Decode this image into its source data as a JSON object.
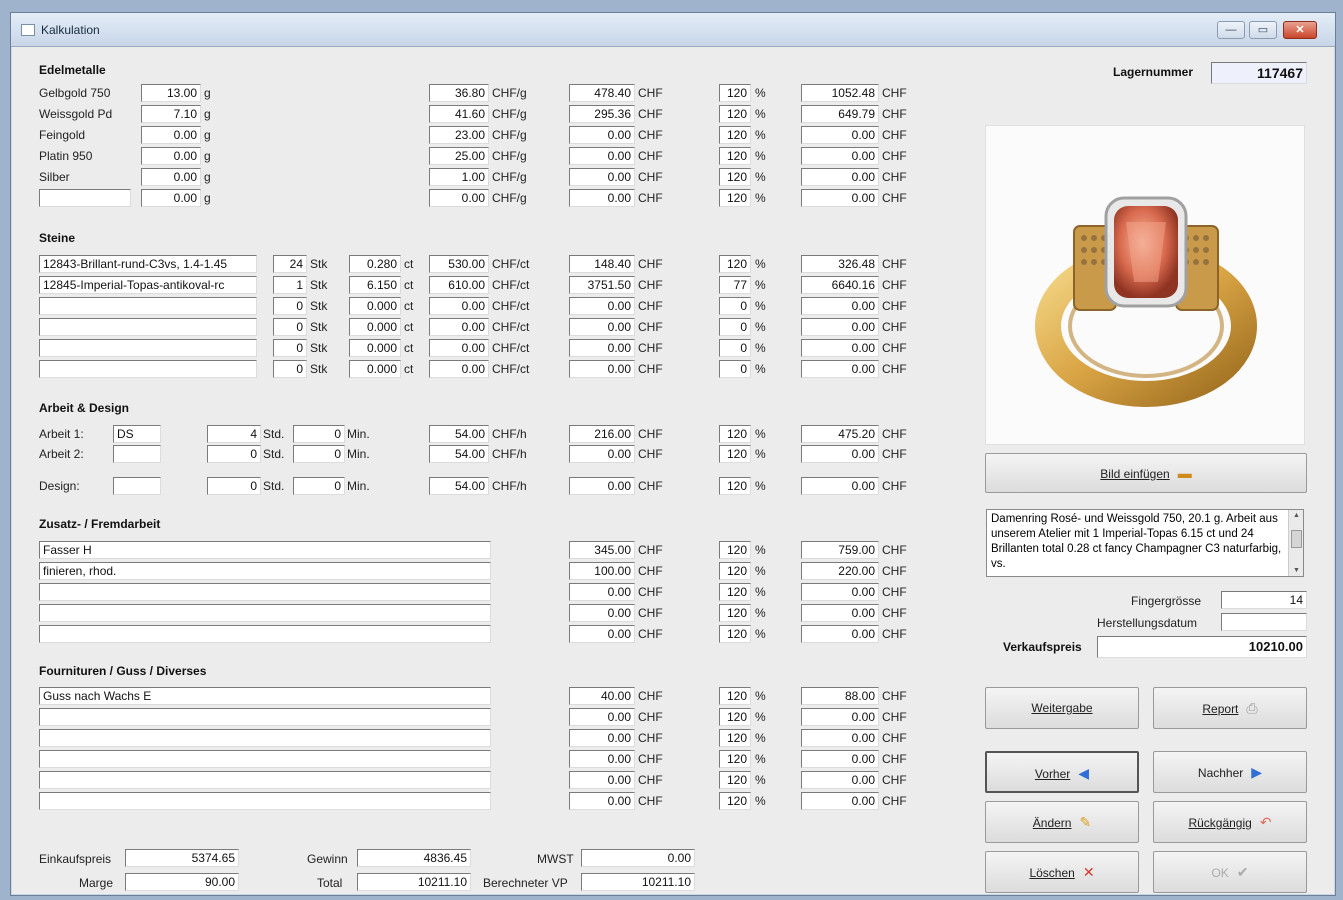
{
  "window": {
    "title": "Kalkulation",
    "minimize": "—",
    "maximize": "▭",
    "close": "✕"
  },
  "lagernummer": {
    "label": "Lagernummer",
    "value": "117467"
  },
  "edelmetalle": {
    "title": "Edelmetalle",
    "rows": [
      {
        "name": "Gelbgold 750",
        "qty": "13.00",
        "qty_unit": "g",
        "price": "36.80",
        "price_unit": "CHF/g",
        "cost": "478.40",
        "cost_unit": "CHF",
        "pct": "120",
        "pct_unit": "%",
        "total": "1052.48",
        "total_unit": "CHF"
      },
      {
        "name": "Weissgold Pd",
        "qty": "7.10",
        "qty_unit": "g",
        "price": "41.60",
        "price_unit": "CHF/g",
        "cost": "295.36",
        "cost_unit": "CHF",
        "pct": "120",
        "pct_unit": "%",
        "total": "649.79",
        "total_unit": "CHF"
      },
      {
        "name": "Feingold",
        "qty": "0.00",
        "qty_unit": "g",
        "price": "23.00",
        "price_unit": "CHF/g",
        "cost": "0.00",
        "cost_unit": "CHF",
        "pct": "120",
        "pct_unit": "%",
        "total": "0.00",
        "total_unit": "CHF"
      },
      {
        "name": "Platin 950",
        "qty": "0.00",
        "qty_unit": "g",
        "price": "25.00",
        "price_unit": "CHF/g",
        "cost": "0.00",
        "cost_unit": "CHF",
        "pct": "120",
        "pct_unit": "%",
        "total": "0.00",
        "total_unit": "CHF"
      },
      {
        "name": "Silber",
        "qty": "0.00",
        "qty_unit": "g",
        "price": "1.00",
        "price_unit": "CHF/g",
        "cost": "0.00",
        "cost_unit": "CHF",
        "pct": "120",
        "pct_unit": "%",
        "total": "0.00",
        "total_unit": "CHF"
      },
      {
        "name": "",
        "qty": "0.00",
        "qty_unit": "g",
        "price": "0.00",
        "price_unit": "CHF/g",
        "cost": "0.00",
        "cost_unit": "CHF",
        "pct": "120",
        "pct_unit": "%",
        "total": "0.00",
        "total_unit": "CHF"
      }
    ]
  },
  "steine": {
    "title": "Steine",
    "rows": [
      {
        "name": "12843-Brillant-rund-C3vs, 1.4-1.45",
        "stk": "24",
        "stk_unit": "Stk",
        "ct": "0.280",
        "ct_unit": "ct",
        "price": "530.00",
        "price_unit": "CHF/ct",
        "cost": "148.40",
        "cost_unit": "CHF",
        "pct": "120",
        "pct_unit": "%",
        "total": "326.48",
        "total_unit": "CHF"
      },
      {
        "name": "12845-Imperial-Topas-antikoval-rc",
        "stk": "1",
        "stk_unit": "Stk",
        "ct": "6.150",
        "ct_unit": "ct",
        "price": "610.00",
        "price_unit": "CHF/ct",
        "cost": "3751.50",
        "cost_unit": "CHF",
        "pct": "77",
        "pct_unit": "%",
        "total": "6640.16",
        "total_unit": "CHF"
      },
      {
        "name": "",
        "stk": "0",
        "stk_unit": "Stk",
        "ct": "0.000",
        "ct_unit": "ct",
        "price": "0.00",
        "price_unit": "CHF/ct",
        "cost": "0.00",
        "cost_unit": "CHF",
        "pct": "0",
        "pct_unit": "%",
        "total": "0.00",
        "total_unit": "CHF"
      },
      {
        "name": "",
        "stk": "0",
        "stk_unit": "Stk",
        "ct": "0.000",
        "ct_unit": "ct",
        "price": "0.00",
        "price_unit": "CHF/ct",
        "cost": "0.00",
        "cost_unit": "CHF",
        "pct": "0",
        "pct_unit": "%",
        "total": "0.00",
        "total_unit": "CHF"
      },
      {
        "name": "",
        "stk": "0",
        "stk_unit": "Stk",
        "ct": "0.000",
        "ct_unit": "ct",
        "price": "0.00",
        "price_unit": "CHF/ct",
        "cost": "0.00",
        "cost_unit": "CHF",
        "pct": "0",
        "pct_unit": "%",
        "total": "0.00",
        "total_unit": "CHF"
      },
      {
        "name": "",
        "stk": "0",
        "stk_unit": "Stk",
        "ct": "0.000",
        "ct_unit": "ct",
        "price": "0.00",
        "price_unit": "CHF/ct",
        "cost": "0.00",
        "cost_unit": "CHF",
        "pct": "0",
        "pct_unit": "%",
        "total": "0.00",
        "total_unit": "CHF"
      }
    ]
  },
  "arbeit": {
    "title": "Arbeit & Design",
    "rows": [
      {
        "label": "Arbeit 1:",
        "who": "DS",
        "std": "4",
        "std_unit": "Std.",
        "min": "0",
        "min_unit": "Min.",
        "price": "54.00",
        "price_unit": "CHF/h",
        "cost": "216.00",
        "cost_unit": "CHF",
        "pct": "120",
        "pct_unit": "%",
        "total": "475.20",
        "total_unit": "CHF"
      },
      {
        "label": "Arbeit 2:",
        "who": "",
        "std": "0",
        "std_unit": "Std.",
        "min": "0",
        "min_unit": "Min.",
        "price": "54.00",
        "price_unit": "CHF/h",
        "cost": "0.00",
        "cost_unit": "CHF",
        "pct": "120",
        "pct_unit": "%",
        "total": "0.00",
        "total_unit": "CHF"
      },
      {
        "label": "Design:",
        "who": "",
        "std": "0",
        "std_unit": "Std.",
        "min": "0",
        "min_unit": "Min.",
        "price": "54.00",
        "price_unit": "CHF/h",
        "cost": "0.00",
        "cost_unit": "CHF",
        "pct": "120",
        "pct_unit": "%",
        "total": "0.00",
        "total_unit": "CHF"
      }
    ]
  },
  "zusatz": {
    "title": "Zusatz- / Fremdarbeit",
    "rows": [
      {
        "desc": "Fasser H",
        "cost": "345.00",
        "cost_unit": "CHF",
        "pct": "120",
        "pct_unit": "%",
        "total": "759.00",
        "total_unit": "CHF"
      },
      {
        "desc": "finieren, rhod.",
        "cost": "100.00",
        "cost_unit": "CHF",
        "pct": "120",
        "pct_unit": "%",
        "total": "220.00",
        "total_unit": "CHF"
      },
      {
        "desc": "",
        "cost": "0.00",
        "cost_unit": "CHF",
        "pct": "120",
        "pct_unit": "%",
        "total": "0.00",
        "total_unit": "CHF"
      },
      {
        "desc": "",
        "cost": "0.00",
        "cost_unit": "CHF",
        "pct": "120",
        "pct_unit": "%",
        "total": "0.00",
        "total_unit": "CHF"
      },
      {
        "desc": "",
        "cost": "0.00",
        "cost_unit": "CHF",
        "pct": "120",
        "pct_unit": "%",
        "total": "0.00",
        "total_unit": "CHF"
      }
    ]
  },
  "fourn": {
    "title": "Fournituren / Guss / Diverses",
    "rows": [
      {
        "desc": "Guss nach Wachs E",
        "cost": "40.00",
        "cost_unit": "CHF",
        "pct": "120",
        "pct_unit": "%",
        "total": "88.00",
        "total_unit": "CHF"
      },
      {
        "desc": "",
        "cost": "0.00",
        "cost_unit": "CHF",
        "pct": "120",
        "pct_unit": "%",
        "total": "0.00",
        "total_unit": "CHF"
      },
      {
        "desc": "",
        "cost": "0.00",
        "cost_unit": "CHF",
        "pct": "120",
        "pct_unit": "%",
        "total": "0.00",
        "total_unit": "CHF"
      },
      {
        "desc": "",
        "cost": "0.00",
        "cost_unit": "CHF",
        "pct": "120",
        "pct_unit": "%",
        "total": "0.00",
        "total_unit": "CHF"
      },
      {
        "desc": "",
        "cost": "0.00",
        "cost_unit": "CHF",
        "pct": "120",
        "pct_unit": "%",
        "total": "0.00",
        "total_unit": "CHF"
      },
      {
        "desc": "",
        "cost": "0.00",
        "cost_unit": "CHF",
        "pct": "120",
        "pct_unit": "%",
        "total": "0.00",
        "total_unit": "CHF"
      }
    ]
  },
  "summary": {
    "einkaufspreis_label": "Einkaufspreis",
    "einkaufspreis": "5374.65",
    "marge_label": "Marge",
    "marge": "90.00",
    "gewinn_label": "Gewinn",
    "gewinn": "4836.45",
    "total_label": "Total",
    "total": "10211.10",
    "mwst_label": "MWST",
    "mwst": "0.00",
    "berechneter_label": "Berechneter VP",
    "berechneter": "10211.10"
  },
  "right": {
    "bild_einfuegen": "Bild einfügen",
    "description": "Damenring Rosé- und Weissgold 750, 20.1 g. Arbeit aus unserem Atelier mit 1 Imperial-Topas 6.15 ct und 24 Brillanten total 0.28 ct fancy Champagner C3 naturfarbig, vs.",
    "fingergroesse_label": "Fingergrösse",
    "fingergroesse": "14",
    "herstellungsdatum_label": "Herstellungsdatum",
    "herstellungsdatum": "",
    "verkaufspreis_label": "Verkaufspreis",
    "verkaufspreis": "10210.00"
  },
  "buttons": {
    "weitergabe": "Weitergabe",
    "report": "Report",
    "vorher": "Vorher",
    "nachher": "Nachher",
    "aendern": "Ändern",
    "rueckgaengig": "Rückgängig",
    "loeschen": "Löschen",
    "ok": "OK"
  },
  "colors": {
    "accent_blue": "#2f6fd6",
    "delete_red": "#d23a2a",
    "titlebar": "#c8d6e8",
    "window_bg": "#ececec"
  }
}
